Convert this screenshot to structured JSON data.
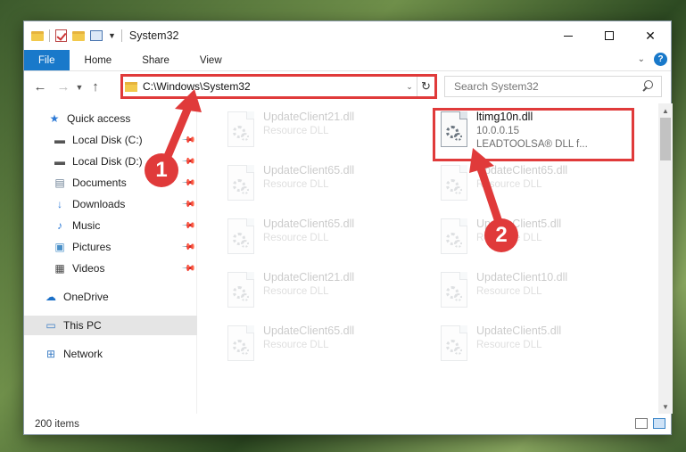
{
  "window": {
    "title": "System32"
  },
  "ribbon": {
    "tabs": [
      "File",
      "Home",
      "Share",
      "View"
    ]
  },
  "navbar": {
    "address": "C:\\Windows\\System32",
    "search_placeholder": "Search System32"
  },
  "sidebar": {
    "items": [
      {
        "label": "Quick access",
        "icon": "star-icon"
      },
      {
        "label": "Local Disk (C:)",
        "icon": "drive-icon"
      },
      {
        "label": "Local Disk (D:)",
        "icon": "drive-icon"
      },
      {
        "label": "Documents",
        "icon": "documents-icon"
      },
      {
        "label": "Downloads",
        "icon": "download-icon"
      },
      {
        "label": "Music",
        "icon": "music-icon"
      },
      {
        "label": "Pictures",
        "icon": "pictures-icon"
      },
      {
        "label": "Videos",
        "icon": "videos-icon"
      },
      {
        "label": "OneDrive",
        "icon": "cloud-icon"
      },
      {
        "label": "This PC",
        "icon": "computer-icon"
      },
      {
        "label": "Network",
        "icon": "network-icon"
      }
    ]
  },
  "files": {
    "left_column": [
      {
        "name": "UpdateClient21.dll",
        "type": "Resource DLL"
      },
      {
        "name": "UpdateClient65.dll",
        "type": "Resource DLL"
      },
      {
        "name": "UpdateClient65.dll",
        "type": "Resource DLL"
      },
      {
        "name": "UpdateClient21.dll",
        "type": "Resource DLL"
      },
      {
        "name": "UpdateClient65.dll",
        "type": "Resource DLL"
      }
    ],
    "right_column": [
      {
        "name": "ltimg10n.dll",
        "version": "10.0.0.15",
        "type": "LEADTOOLSA® DLL f..."
      },
      {
        "name": "UpdateClient65.dll",
        "type": "Resource DLL"
      },
      {
        "name": "UpdateClient5.dll",
        "type": "Resource DLL"
      },
      {
        "name": "UpdateClient10.dll",
        "type": "Resource DLL"
      },
      {
        "name": "UpdateClient5.dll",
        "type": "Resource DLL"
      }
    ]
  },
  "status": {
    "item_count": "200 items"
  },
  "annotations": {
    "step1": "1",
    "step2": "2",
    "color": "#e03a3a"
  }
}
